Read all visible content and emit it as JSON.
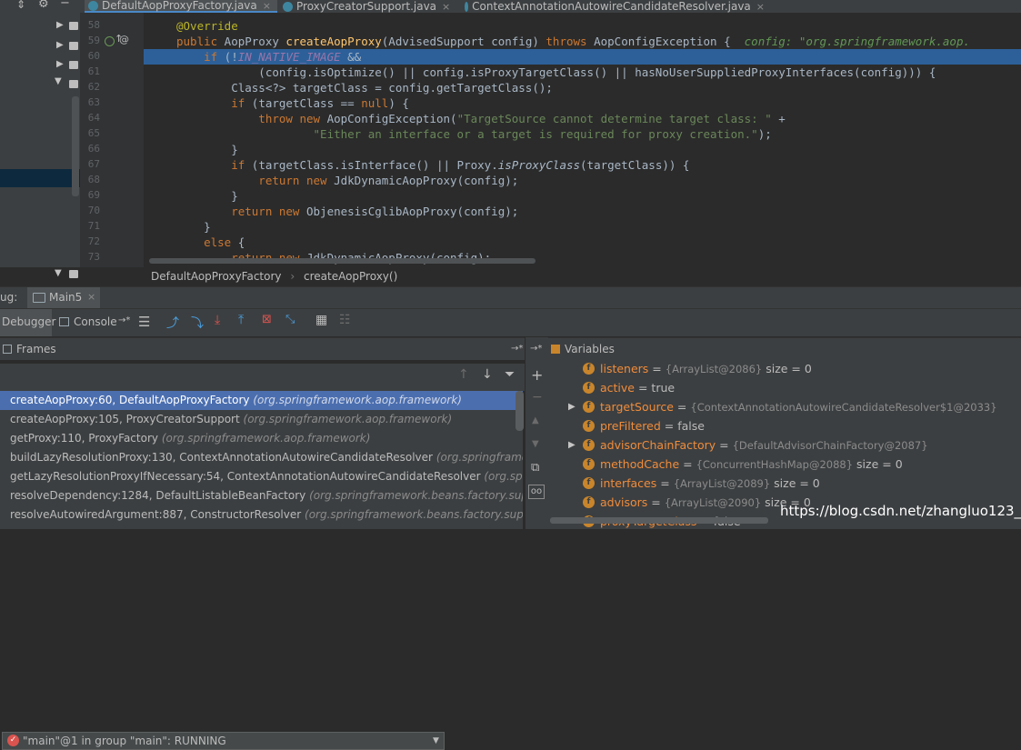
{
  "tabs": [
    {
      "label": "DefaultAopProxyFactory.java"
    },
    {
      "label": "ProxyCreatorSupport.java"
    },
    {
      "label": "ContextAnnotationAutowireCandidateResolver.java"
    }
  ],
  "gutter_lines": [
    "58",
    "59",
    "60",
    "61",
    "62",
    "63",
    "64",
    "65",
    "66",
    "67",
    "68",
    "69",
    "70",
    "71",
    "72",
    "73"
  ],
  "code": {
    "l58": "@Override",
    "l59_kw": "public",
    "l59_type": " AopProxy ",
    "l59_fn": "createAopProxy",
    "l59_rest": "(AdvisedSupport config) ",
    "l59_throws": "throws",
    "l59_exc": " AopConfigException {  ",
    "l59_hint": "config: \"org.springframework.aop.",
    "l60_if": "    if",
    "l60_a": " (!",
    "l60_const": "IN_NATIVE_IMAGE",
    "l60_b": " &&",
    "l61": "            (config.isOptimize() || config.isProxyTargetClass() || hasNoUserSuppliedProxyInterfaces(config))) {",
    "l62": "        Class<?> targetClass = config.getTargetClass();",
    "l63_kw": "        if",
    "l63_a": " (targetClass == ",
    "l63_null": "null",
    "l63_b": ") {",
    "l64_kw": "            throw new",
    "l64_a": " AopConfigException(",
    "l64_str": "\"TargetSource cannot determine target class: \"",
    "l64_b": " +",
    "l65_str": "                    \"Either an interface or a target is required for proxy creation.\"",
    "l65_b": ");",
    "l66": "        }",
    "l67_kw": "        if",
    "l67_a": " (targetClass.isInterface() || Proxy.",
    "l67_it": "isProxyClass",
    "l67_b": "(targetClass)) {",
    "l68_kw": "            return new",
    "l68_a": " JdkDynamicAopProxy(config);",
    "l69": "        }",
    "l70_kw": "        return new",
    "l70_a": " ObjenesisCglibAopProxy(config);",
    "l71": "    }",
    "l72_kw": "    else",
    "l72_a": " {",
    "l73_kw": "        return new",
    "l73_a": " JdkDynamicAopProxy(config);"
  },
  "breadcrumb": {
    "class": "DefaultAopProxyFactory",
    "sep": "›",
    "method": "createAopProxy()"
  },
  "debug": {
    "prefix": "ug:",
    "session": "Main5",
    "debugger_tab": "Debugger",
    "console_tab": "Console",
    "console_arrow": "→*"
  },
  "frames": {
    "title": "Frames",
    "thread": "\"main\"@1 in group \"main\": RUNNING",
    "items": [
      {
        "m": "createAopProxy:60, DefaultAopProxyFactory",
        "p": "(org.springframework.aop.framework)"
      },
      {
        "m": "createAopProxy:105, ProxyCreatorSupport",
        "p": "(org.springframework.aop.framework)"
      },
      {
        "m": "getProxy:110, ProxyFactory",
        "p": "(org.springframework.aop.framework)"
      },
      {
        "m": "buildLazyResolutionProxy:130, ContextAnnotationAutowireCandidateResolver",
        "p": "(org.springframewo"
      },
      {
        "m": "getLazyResolutionProxyIfNecessary:54, ContextAnnotationAutowireCandidateResolver",
        "p": "(org.spring"
      },
      {
        "m": "resolveDependency:1284, DefaultListableBeanFactory",
        "p": "(org.springframework.beans.factory.suppor"
      },
      {
        "m": "resolveAutowiredArgument:887, ConstructorResolver",
        "p": "(org.springframework.beans.factory.suppor"
      }
    ]
  },
  "variables": {
    "title": "Variables",
    "items": [
      {
        "name": "listeners",
        "eq": " = ",
        "type": "{ArrayList@2086}",
        "extra": "  size = 0",
        "expand": false
      },
      {
        "name": "active",
        "eq": " = ",
        "type": "",
        "extra": "true",
        "expand": false
      },
      {
        "name": "targetSource",
        "eq": " = ",
        "type": "{ContextAnnotationAutowireCandidateResolver$1@2033}",
        "extra": "",
        "expand": true
      },
      {
        "name": "preFiltered",
        "eq": " = ",
        "type": "",
        "extra": "false",
        "expand": false
      },
      {
        "name": "advisorChainFactory",
        "eq": " = ",
        "type": "{DefaultAdvisorChainFactory@2087}",
        "extra": "",
        "expand": true
      },
      {
        "name": "methodCache",
        "eq": " = ",
        "type": "{ConcurrentHashMap@2088}",
        "extra": "  size = 0",
        "expand": false
      },
      {
        "name": "interfaces",
        "eq": " = ",
        "type": "{ArrayList@2089}",
        "extra": "  size = 0",
        "expand": false
      },
      {
        "name": "advisors",
        "eq": " = ",
        "type": "{ArrayList@2090}",
        "extra": "  size = 0",
        "expand": false
      },
      {
        "name": "proxyTargetClass",
        "eq": " = ",
        "type": "",
        "extra": "false",
        "expand": false
      }
    ]
  },
  "watermark": "https://blog.csdn.net/zhangluo123__",
  "colors": {
    "accent": "#4b6eaf",
    "highlight_line": "#2d6099",
    "keyword": "#cc7832",
    "string": "#6a8759"
  }
}
